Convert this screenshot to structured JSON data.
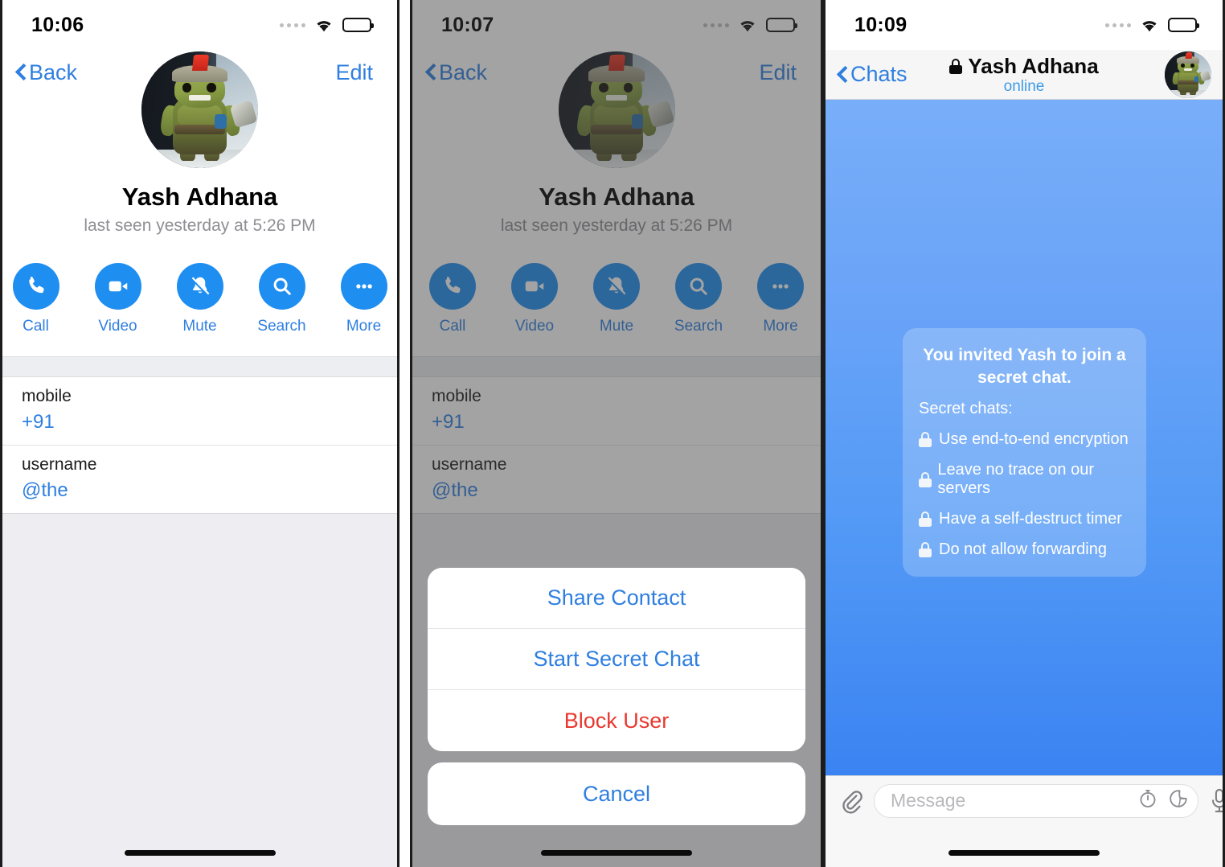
{
  "accent": {
    "telegram_blue": "#1f8ef1",
    "link_blue": "#2f7fe0",
    "danger_red": "#e8382f",
    "chat_bg_top": "#78aef9",
    "chat_bg_bottom": "#3b83f2",
    "subtitle_gray": "#8e8e93"
  },
  "panel1": {
    "status": {
      "time": "10:06",
      "signal_icon": "signal-dots-icon",
      "wifi_icon": "wifi-icon",
      "battery_icon": "battery-icon"
    },
    "nav": {
      "back_label": "Back",
      "back_icon": "chevron-left-icon",
      "edit_label": "Edit"
    },
    "profile": {
      "avatar_icon": "contact-avatar",
      "name": "Yash Adhana",
      "status": "last seen yesterday at 5:26 PM"
    },
    "actions": [
      {
        "label": "Call",
        "icon": "phone-icon"
      },
      {
        "label": "Video",
        "icon": "video-camera-icon"
      },
      {
        "label": "Mute",
        "icon": "bell-slash-icon"
      },
      {
        "label": "Search",
        "icon": "search-icon"
      },
      {
        "label": "More",
        "icon": "ellipsis-icon"
      }
    ],
    "info_rows": [
      {
        "label": "mobile",
        "value": "+91"
      },
      {
        "label": "username",
        "value": "@the"
      }
    ]
  },
  "panel2": {
    "status": {
      "time": "10:07",
      "signal_icon": "signal-dots-icon",
      "wifi_icon": "wifi-icon",
      "battery_icon": "battery-icon"
    },
    "nav": {
      "back_label": "Back",
      "back_icon": "chevron-left-icon",
      "edit_label": "Edit"
    },
    "profile": {
      "avatar_icon": "contact-avatar",
      "name": "Yash Adhana",
      "status": "last seen yesterday at 5:26 PM"
    },
    "actions": [
      {
        "label": "Call",
        "icon": "phone-icon"
      },
      {
        "label": "Video",
        "icon": "video-camera-icon"
      },
      {
        "label": "Mute",
        "icon": "bell-slash-icon"
      },
      {
        "label": "Search",
        "icon": "search-icon"
      },
      {
        "label": "More",
        "icon": "ellipsis-icon"
      }
    ],
    "info_rows": [
      {
        "label": "mobile",
        "value": "+91"
      },
      {
        "label": "username",
        "value": "@the"
      }
    ],
    "action_sheet": {
      "items": [
        {
          "label": "Share Contact",
          "style": "default"
        },
        {
          "label": "Start Secret Chat",
          "style": "default"
        },
        {
          "label": "Block User",
          "style": "destructive"
        }
      ],
      "cancel_label": "Cancel"
    }
  },
  "panel3": {
    "status": {
      "time": "10:09",
      "signal_icon": "signal-dots-icon",
      "wifi_icon": "wifi-icon",
      "battery_icon": "battery-icon"
    },
    "nav": {
      "back_label": "Chats",
      "back_icon": "chevron-left-icon",
      "lock_icon": "lock-icon",
      "title": "Yash Adhana",
      "subtitle": "online",
      "avatar_icon": "contact-avatar"
    },
    "secret_chat_notice": {
      "title": "You invited Yash to join a secret chat.",
      "lead": "Secret chats:",
      "bullets": [
        {
          "lock_icon": "lock-icon",
          "text": "Use end-to-end encryption"
        },
        {
          "lock_icon": "lock-icon",
          "text": "Leave no trace on our servers"
        },
        {
          "lock_icon": "lock-icon",
          "text": "Have a self-destruct timer"
        },
        {
          "lock_icon": "lock-icon",
          "text": "Do not allow forwarding"
        }
      ]
    },
    "input_bar": {
      "attach_icon": "paperclip-icon",
      "placeholder": "Message",
      "value": "",
      "timer_icon": "stopwatch-icon",
      "sticker_icon": "sticker-icon",
      "mic_icon": "microphone-icon"
    }
  }
}
